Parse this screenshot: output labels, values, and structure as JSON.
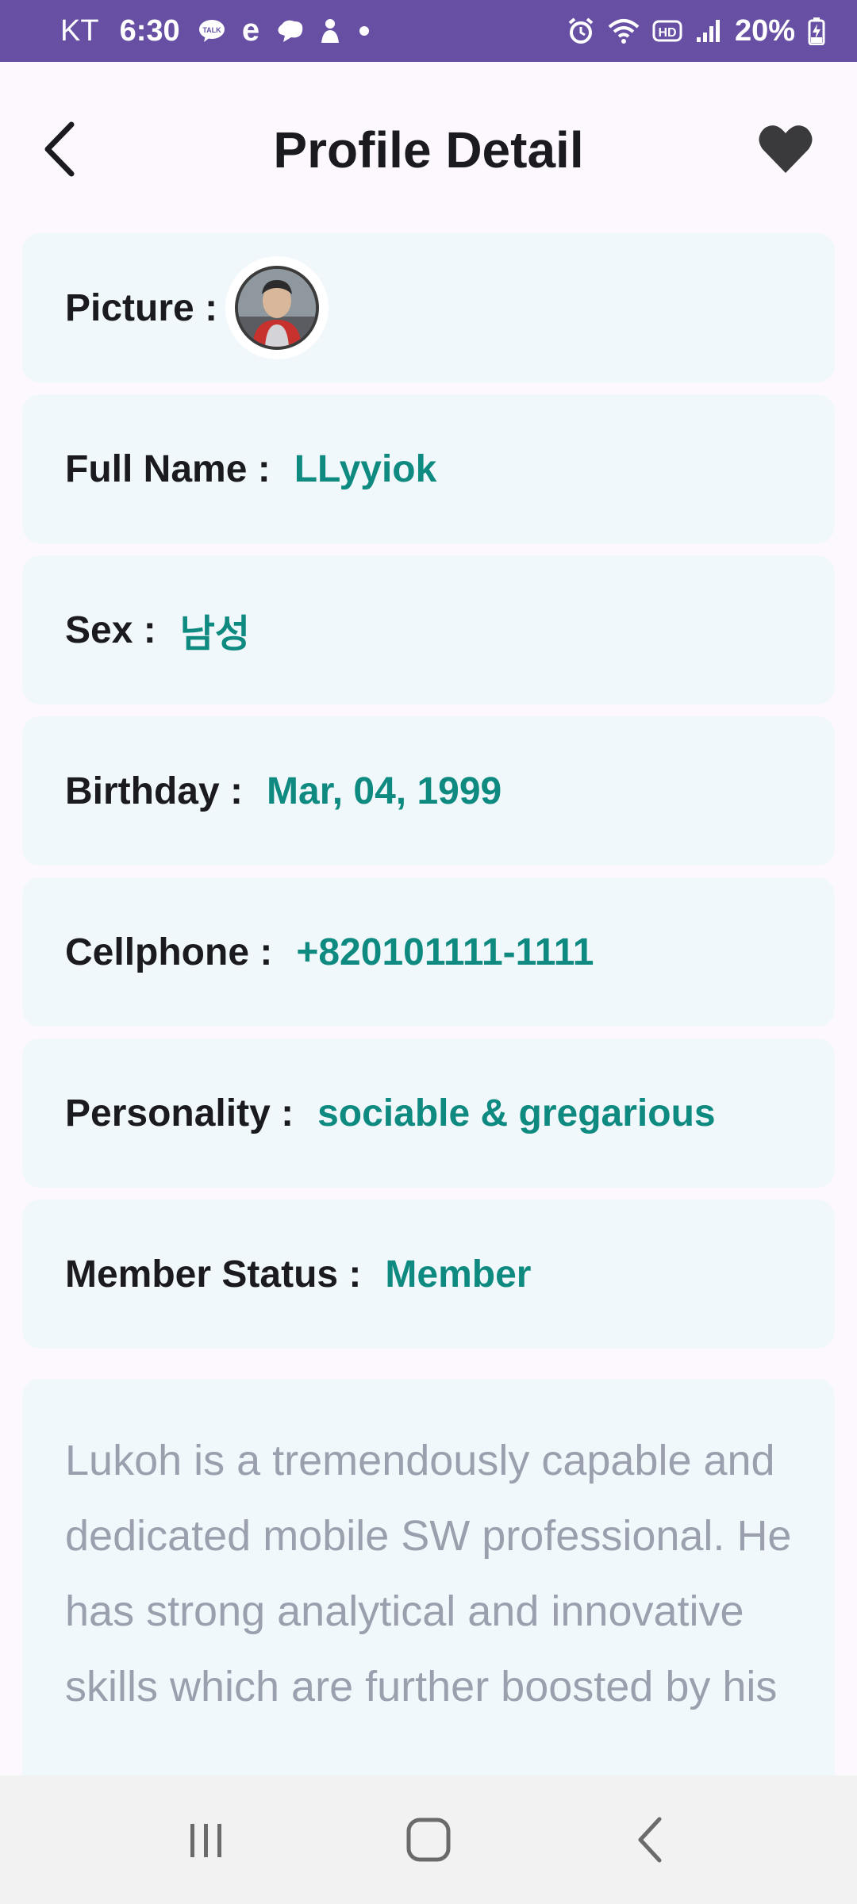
{
  "status_bar": {
    "carrier": "KT",
    "time": "6:30",
    "battery": "20%",
    "icons_left": [
      "talk-bubble-icon",
      "e-icon",
      "chat-cloud-icon",
      "notification-icon",
      "dot-icon"
    ],
    "icons_right": [
      "alarm-icon",
      "wifi-icon",
      "hd-icon",
      "signal-icon",
      "battery-charging-icon"
    ],
    "bg_color": "#6750a4"
  },
  "header": {
    "title": "Profile Detail",
    "back_icon": "back-arrow-icon",
    "favorite_icon": "heart-icon"
  },
  "profile": {
    "picture_label": "Picture :",
    "full_name_label": "Full Name :",
    "full_name": "LLyyiok",
    "sex_label": "Sex :",
    "sex": "남성",
    "birthday_label": "Birthday :",
    "birthday": "Mar, 04, 1999",
    "cellphone_label": "Cellphone :",
    "cellphone": "+820101111-1111",
    "personality_label": "Personality :",
    "personality": "sociable & gregarious",
    "member_status_label": "Member Status :",
    "member_status": "Member",
    "bio": "Lukoh is a tremendously capable and dedicated mobile SW professional. He has strong analytical and innovative skills which are further boosted by his"
  },
  "colors": {
    "value_text": "#0e8a80",
    "card_bg": "#f1f8fb",
    "bio_text": "#9aa0ad"
  },
  "nav_bar": {
    "icons": [
      "recents-icon",
      "home-icon",
      "back-icon"
    ]
  }
}
